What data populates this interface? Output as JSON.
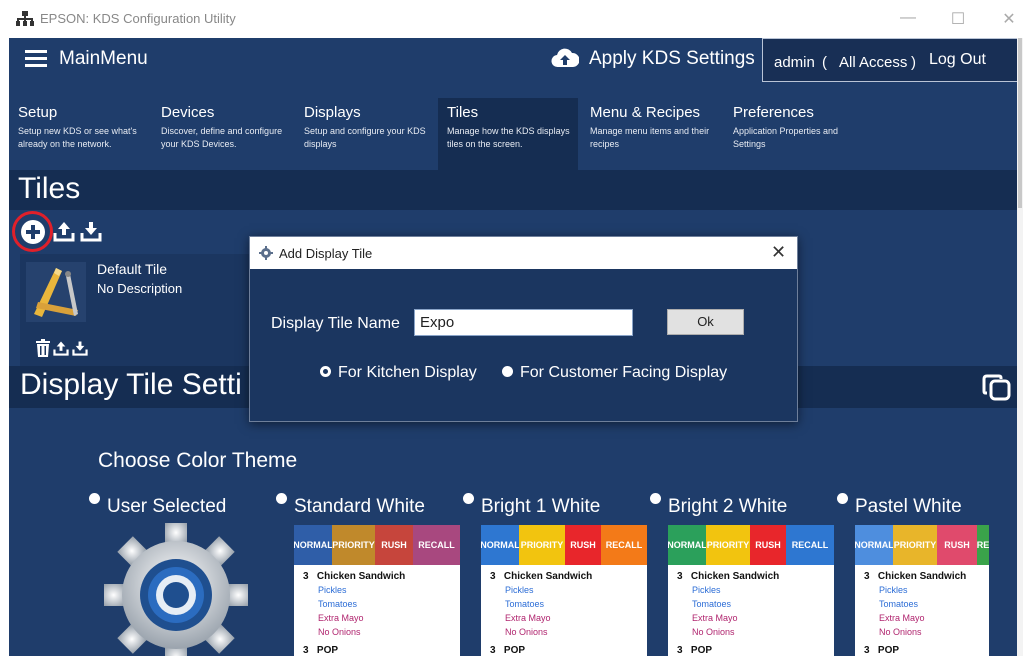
{
  "window": {
    "title": "EPSON: KDS Configuration Utility",
    "minimize": "—",
    "maximize": "☐",
    "close": "✕"
  },
  "header": {
    "menu_label": "MainMenu",
    "apply_label": "Apply KDS Settings",
    "user": "admin",
    "paren_open": "(",
    "access": "All Access",
    "paren_close": ")",
    "logout": "Log Out"
  },
  "tabs": [
    {
      "name": "Setup",
      "desc": "Setup new KDS or see what's already on the network."
    },
    {
      "name": "Devices",
      "desc": "Discover, define and configure your KDS Devices."
    },
    {
      "name": "Displays",
      "desc": "Setup and configure your KDS displays"
    },
    {
      "name": "Tiles",
      "desc": "Manage how the KDS displays tiles on the screen."
    },
    {
      "name": "Menu & Recipes",
      "desc": "Manage menu items and their recipes"
    },
    {
      "name": "Preferences",
      "desc": "Application Properties and Settings"
    }
  ],
  "active_tab": "Tiles",
  "tiles": {
    "heading": "Tiles",
    "tile_name": "Default Tile",
    "tile_desc": "No Description"
  },
  "settings": {
    "heading": "Display Tile Setti",
    "choose_theme": "Choose Color Theme",
    "themes": [
      {
        "label": "User Selected"
      },
      {
        "label": "Standard White"
      },
      {
        "label": "Bright 1 White"
      },
      {
        "label": "Bright 2 White"
      },
      {
        "label": "Pastel White"
      }
    ],
    "previews": [
      {
        "bar": [
          {
            "text": "NORMAL",
            "color": "#2f5ea8"
          },
          {
            "text": "PRIORITY",
            "color": "#c0892b"
          },
          {
            "text": "RUSH",
            "color": "#c6453c"
          },
          {
            "text": "RECALL",
            "color": "#a8487f"
          }
        ]
      },
      {
        "bar": [
          {
            "text": "NORMAL",
            "color": "#2e77d1"
          },
          {
            "text": "PRIORITY",
            "color": "#f2c40f"
          },
          {
            "text": "RUSH",
            "color": "#e8262b"
          },
          {
            "text": "RECALL",
            "color": "#f37a18"
          }
        ]
      },
      {
        "bar": [
          {
            "text": "NORMAL",
            "color": "#2ba05b"
          },
          {
            "text": "PRIORITY",
            "color": "#f2c40f"
          },
          {
            "text": "RUSH",
            "color": "#e8262b"
          },
          {
            "text": "RECALL",
            "color": "#2e77d1"
          }
        ]
      },
      {
        "bar": [
          {
            "text": "NORMAL",
            "color": "#4e8ede"
          },
          {
            "text": "PRIORITY",
            "color": "#e8b52a"
          },
          {
            "text": "RUSH",
            "color": "#e04a6c"
          },
          {
            "text": "RE",
            "color": "#3aa34a"
          }
        ]
      }
    ],
    "order": {
      "qty": "3",
      "item": "Chicken Sandwich",
      "mods": [
        {
          "text": "Pickles",
          "color": "#2c6dd6"
        },
        {
          "text": "Tomatoes",
          "color": "#2c6dd6"
        },
        {
          "text": "Extra Mayo",
          "color": "#b0246e"
        },
        {
          "text": "No Onions",
          "color": "#b0246e"
        }
      ],
      "qty2": "3",
      "item2": "POP"
    }
  },
  "dialog": {
    "title": "Add Display Tile",
    "close": "✕",
    "field_label": "Display Tile Name",
    "field_value": "Expo",
    "ok": "Ok",
    "options": [
      {
        "label": "For Kitchen Display",
        "selected": true
      },
      {
        "label": "For Customer Facing Display",
        "selected": false
      }
    ]
  }
}
